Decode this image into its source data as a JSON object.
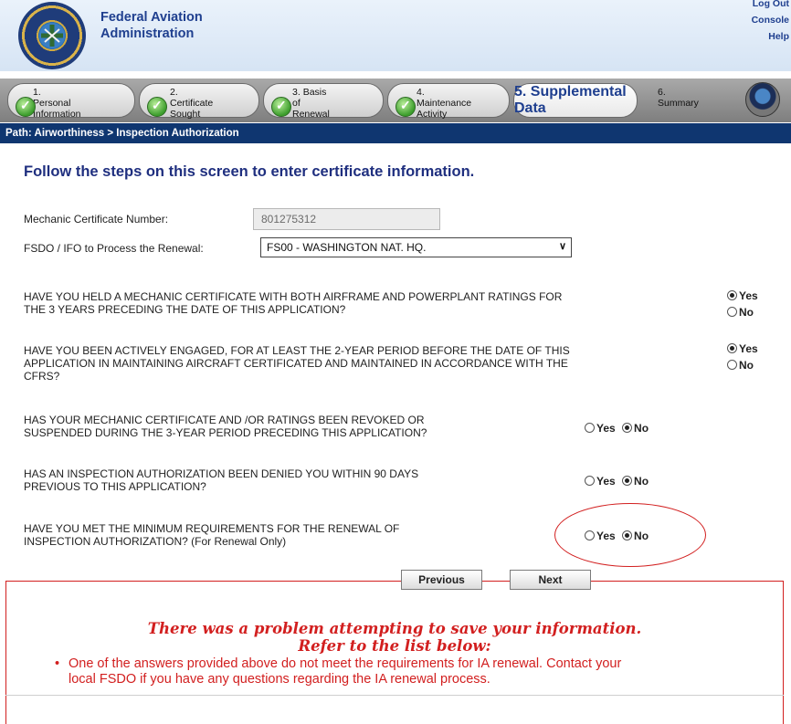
{
  "header": {
    "agency_line1": "Federal Aviation",
    "agency_line2": "Administration",
    "links": [
      "Log Out",
      "Console",
      "Help"
    ]
  },
  "steps": [
    {
      "num": "1.",
      "line1": "Personal",
      "line2": "Information",
      "status": "complete"
    },
    {
      "num": "2.",
      "line1": "Certificate",
      "line2": "Sought",
      "status": "complete"
    },
    {
      "num": "3.",
      "line1": "Basis of",
      "line2": "Renewal",
      "status": "complete"
    },
    {
      "num": "4.",
      "line1": "Maintenance",
      "line2": "Activity",
      "status": "complete"
    },
    {
      "num": "5.",
      "line1": "Supplemental",
      "line2": "Data",
      "status": "error"
    },
    {
      "num": "6.",
      "line1": "Summary",
      "line2": "",
      "status": "pending"
    }
  ],
  "path": "Path: Airworthiness > Inspection Authorization",
  "heading": "Follow the steps on this screen to enter certificate information.",
  "form": {
    "cert_label": "Mechanic Certificate Number:",
    "cert_value": "801275312",
    "fsdo_label": "FSDO / IFO to Process the Renewal:",
    "fsdo_value": "FS00 - WASHINGTON NAT. HQ."
  },
  "questions": [
    {
      "line1": "HAVE YOU HELD A MECHANIC CERTIFICATE WITH BOTH AIRFRAME AND POWERPLANT RATINGS FOR",
      "line2": "THE 3 YEARS PRECEDING THE DATE OF THIS APPLICATION?",
      "line3": "",
      "yes": "Yes",
      "no": "No",
      "selected": "Yes"
    },
    {
      "line1": "HAVE YOU BEEN ACTIVELY ENGAGED, FOR AT LEAST THE 2-YEAR PERIOD BEFORE THE DATE OF THIS",
      "line2": "APPLICATION IN MAINTAINING AIRCRAFT CERTIFICATED AND MAINTAINED IN ACCORDANCE WITH THE",
      "line3": "CFRS?",
      "yes": "Yes",
      "no": "No",
      "selected": "Yes"
    },
    {
      "line1": "HAS YOUR MECHANIC CERTIFICATE AND /OR RATINGS BEEN REVOKED OR",
      "line2": "SUSPENDED DURING THE 3-YEAR PERIOD PRECEDING THIS APPLICATION?",
      "line3": "",
      "yes": "Yes",
      "no": "No",
      "selected": "No"
    },
    {
      "line1": "HAS AN INSPECTION AUTHORIZATION BEEN DENIED YOU WITHIN 90 DAYS",
      "line2": "PREVIOUS TO THIS APPLICATION?",
      "line3": "",
      "yes": "Yes",
      "no": "No",
      "selected": "No"
    },
    {
      "line1": "HAVE YOU MET THE MINIMUM REQUIREMENTS FOR THE RENEWAL OF",
      "line2": "INSPECTION AUTHORIZATION? (For Renewal Only)",
      "line3": "",
      "yes": "Yes",
      "no": "No",
      "selected": "No"
    }
  ],
  "buttons": {
    "previous": "Previous",
    "next": "Next"
  },
  "error": {
    "title1": "There was a problem attempting to save your information.",
    "title2": "Refer to the list below:",
    "message_line1": "One of the answers provided above do not meet the requirements for IA renewal. Contact your",
    "message_line2": "local FSDO if you have any questions regarding the IA renewal process."
  },
  "colors": {
    "brand_blue": "#1f3f8f",
    "path_bar": "#0f3670",
    "error_red": "#d21f1f"
  }
}
